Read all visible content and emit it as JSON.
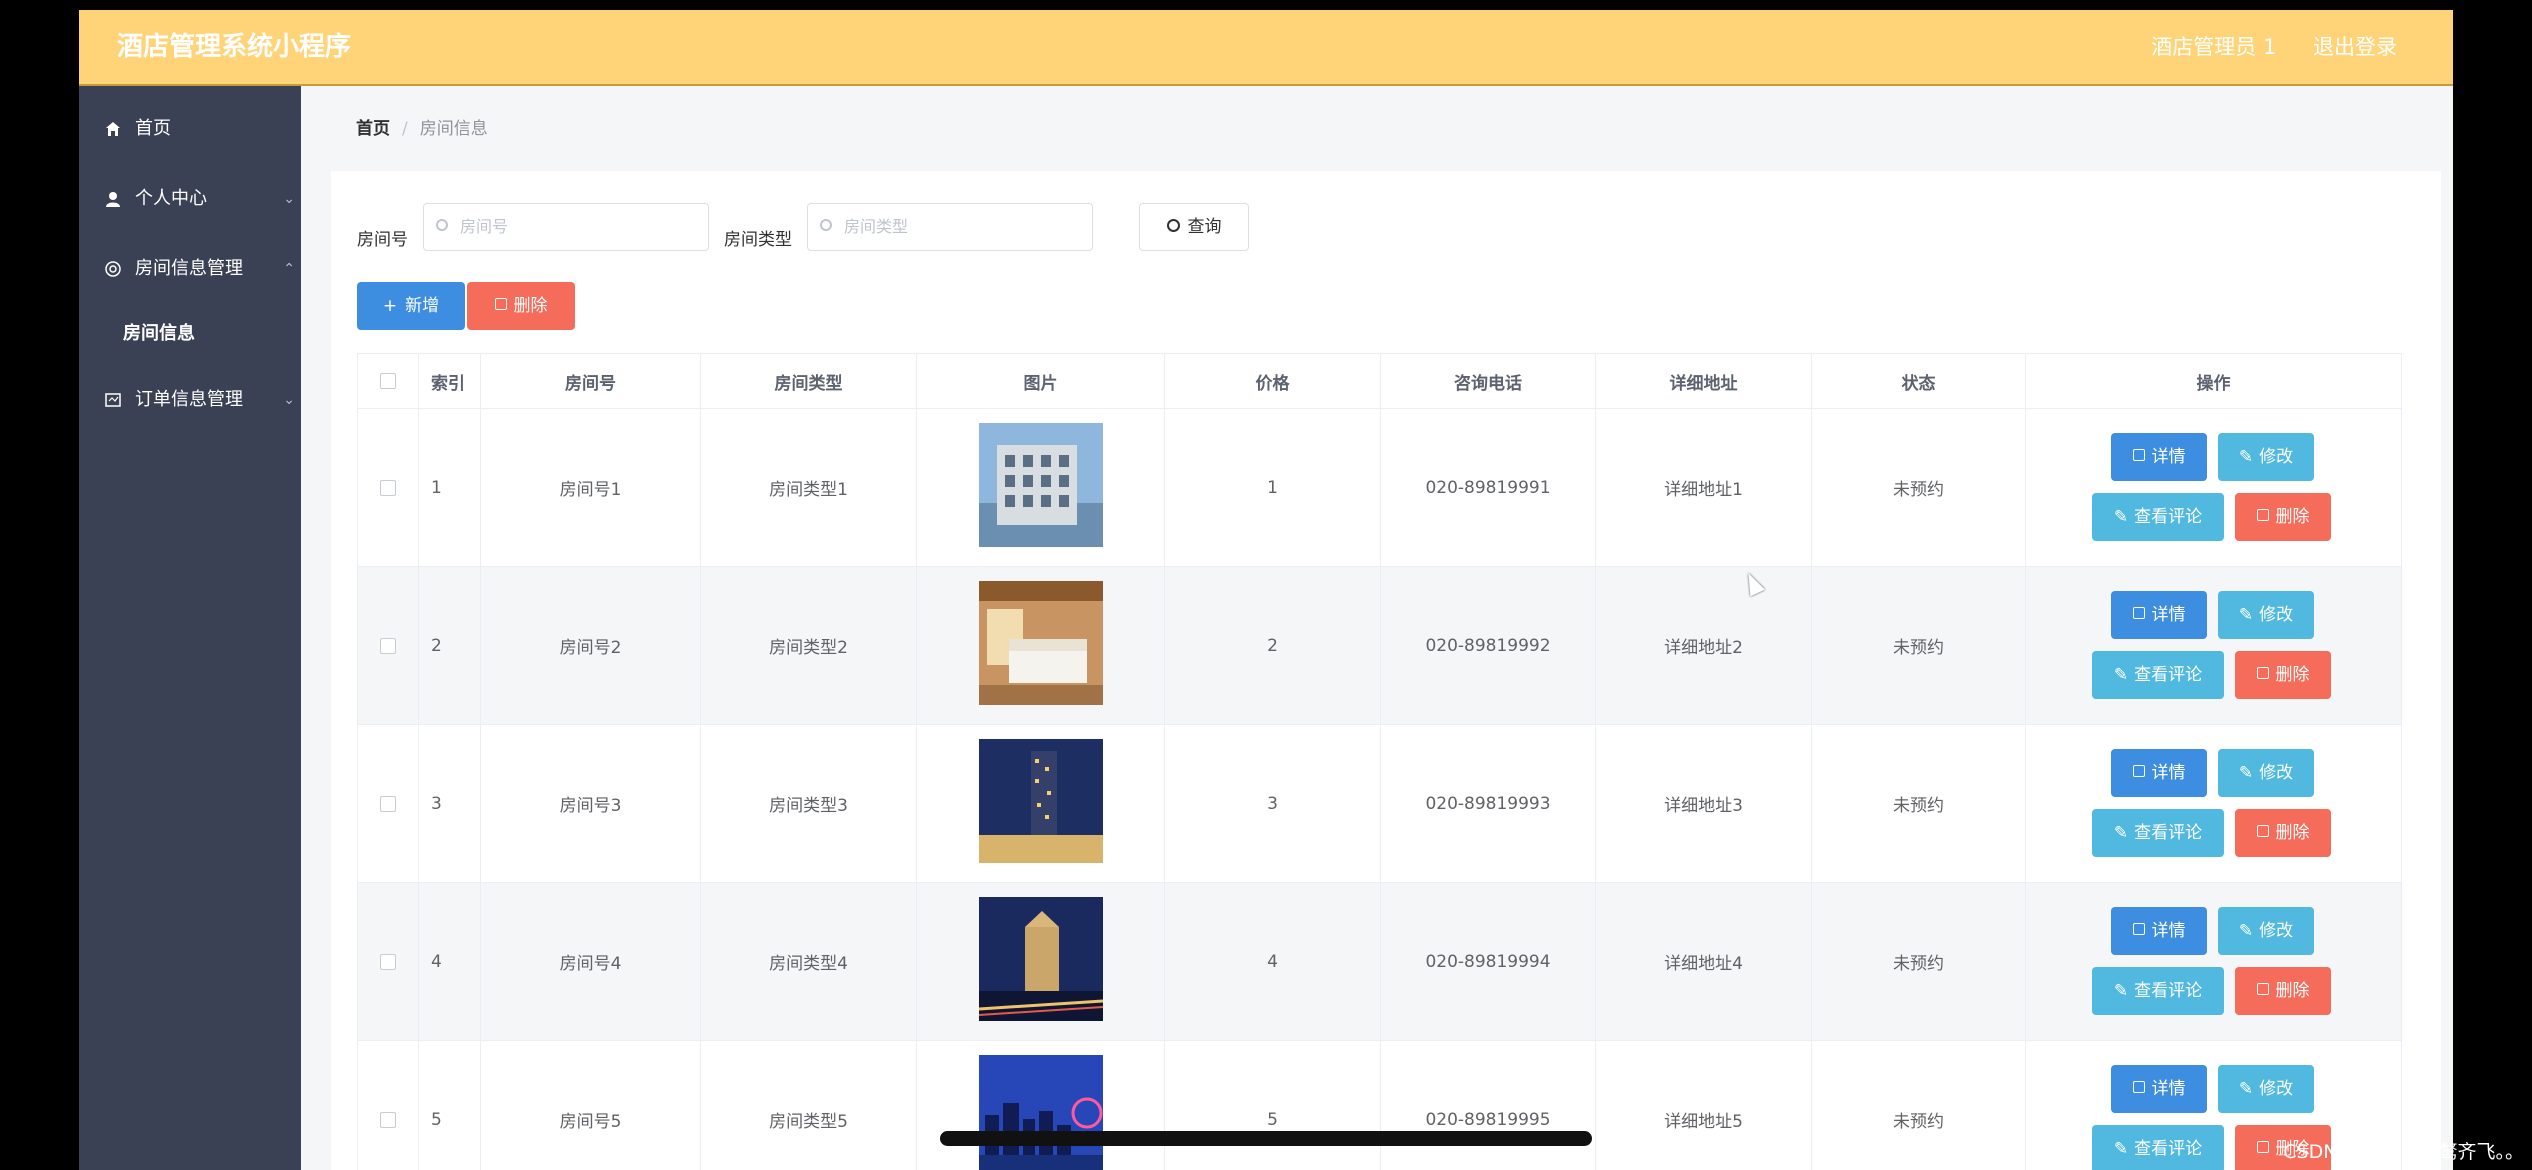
{
  "app": {
    "title": "酒店管理系统小程序",
    "user": "酒店管理员 1",
    "logout": "退出登录"
  },
  "sidebar": {
    "items": [
      {
        "label": "首页",
        "icon": "home-icon"
      },
      {
        "label": "个人中心",
        "icon": "user-icon"
      },
      {
        "label": "房间信息管理",
        "icon": "settings-icon"
      },
      {
        "label": "订单信息管理",
        "icon": "order-icon"
      }
    ],
    "sub_item": "房间信息"
  },
  "breadcrumb": {
    "home": "首页",
    "sep": "/",
    "current": "房间信息"
  },
  "search": {
    "room_label": "房间号",
    "room_placeholder": "房间号",
    "type_label": "房间类型",
    "type_placeholder": "房间类型",
    "query_label": "查询"
  },
  "toolbar": {
    "add_label": "新增",
    "delete_label": "删除",
    "add_icon": "+"
  },
  "table": {
    "headers": [
      "索引",
      "房间号",
      "房间类型",
      "图片",
      "价格",
      "咨询电话",
      "详细地址",
      "状态",
      "操作"
    ],
    "rows": [
      {
        "index": "1",
        "room": "房间号1",
        "type": "房间类型1",
        "price": "1",
        "phone": "020-89819991",
        "address": "详细地址1",
        "status": "未预约",
        "image": "hotel-building"
      },
      {
        "index": "2",
        "room": "房间号2",
        "type": "房间类型2",
        "price": "2",
        "phone": "020-89819992",
        "address": "详细地址2",
        "status": "未预约",
        "image": "hotel-room"
      },
      {
        "index": "3",
        "room": "房间号3",
        "type": "房间类型3",
        "price": "3",
        "phone": "020-89819993",
        "address": "详细地址3",
        "status": "未预约",
        "image": "night-tower"
      },
      {
        "index": "4",
        "room": "房间号4",
        "type": "房间类型4",
        "price": "4",
        "phone": "020-89819994",
        "address": "详细地址4",
        "status": "未预约",
        "image": "night-hotel"
      },
      {
        "index": "5",
        "room": "房间号5",
        "type": "房间类型5",
        "price": "5",
        "phone": "020-89819995",
        "address": "详细地址5",
        "status": "未预约",
        "image": "city-skyline"
      }
    ],
    "actions": {
      "detail": "详情",
      "edit": "修改",
      "review": "查看评论",
      "delete": "删除"
    }
  },
  "watermark": "CSDN @落霞与孤鹜齐飞。。",
  "colors": {
    "topbar": "#ffd479",
    "sidebar": "#3b4155",
    "primary": "#3d8ee0",
    "info": "#51b9df",
    "danger": "#f56c5a"
  }
}
